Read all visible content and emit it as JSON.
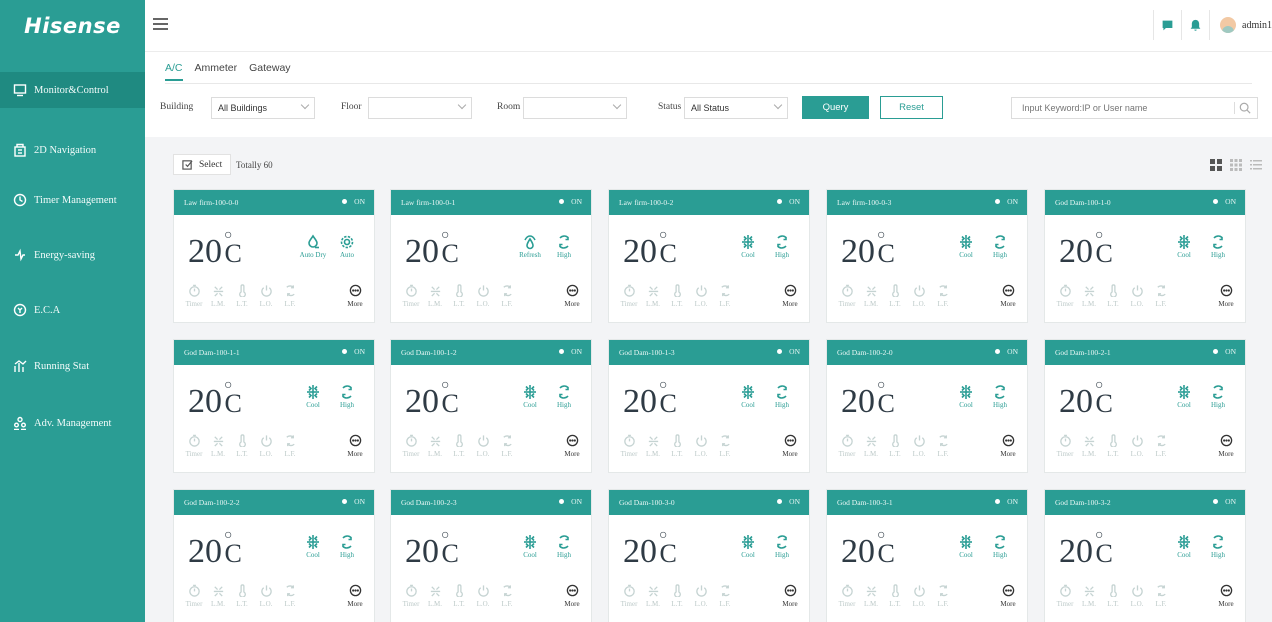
{
  "brand": {
    "logo": "Hisense",
    "accent": "#2a9d94"
  },
  "sidebar": {
    "items": [
      {
        "label": "Monitor&Control",
        "icon": "monitor-icon",
        "active": true
      },
      {
        "label": "2D Navigation",
        "icon": "building-icon"
      },
      {
        "label": "Timer Management",
        "icon": "clock-icon"
      },
      {
        "label": "Energy-saving",
        "icon": "energy-icon"
      },
      {
        "label": "E.C.A",
        "icon": "eca-icon"
      },
      {
        "label": "Running Stat",
        "icon": "stats-icon"
      },
      {
        "label": "Adv. Management",
        "icon": "users-icon"
      }
    ]
  },
  "header": {
    "username": "admin1",
    "icons": [
      "message-icon",
      "bell-icon",
      "avatar"
    ]
  },
  "tabs": [
    {
      "label": "A/C",
      "active": true
    },
    {
      "label": "Ammeter"
    },
    {
      "label": "Gateway"
    }
  ],
  "filters": {
    "building_label": "Building",
    "building_value": "All Buildings",
    "floor_label": "Floor",
    "floor_value": "",
    "room_label": "Room",
    "room_value": "",
    "status_label": "Status",
    "status_value": "All Status",
    "query_label": "Query",
    "reset_label": "Reset",
    "search_placeholder": "Input Keyword:IP or User name"
  },
  "toolbar": {
    "select_label": "Select",
    "total_label": "Totally 60"
  },
  "units": [
    {
      "name": "Law firm-100-0-0",
      "status": "ON",
      "temp": "20",
      "unit": "C",
      "mode": "Auto Dry",
      "mode_icon": "dry-icon",
      "fan": "Auto",
      "fan_icon": "gear-icon"
    },
    {
      "name": "Law firm-100-0-1",
      "status": "ON",
      "temp": "20",
      "unit": "C",
      "mode": "Refresh",
      "mode_icon": "refresh-icon",
      "fan": "High",
      "fan_icon": "fan-speed-icon"
    },
    {
      "name": "Law firm-100-0-2",
      "status": "ON",
      "temp": "20",
      "unit": "C",
      "mode": "Cool",
      "mode_icon": "snowflake-icon",
      "fan": "High",
      "fan_icon": "fan-speed-icon"
    },
    {
      "name": "Law firm-100-0-3",
      "status": "ON",
      "temp": "20",
      "unit": "C",
      "mode": "Cool",
      "mode_icon": "snowflake-icon",
      "fan": "High",
      "fan_icon": "fan-speed-icon"
    },
    {
      "name": "God Dam-100-1-0",
      "status": "ON",
      "temp": "20",
      "unit": "C",
      "mode": "Cool",
      "mode_icon": "snowflake-icon",
      "fan": "High",
      "fan_icon": "fan-speed-icon"
    },
    {
      "name": "God Dam-100-1-1",
      "status": "ON",
      "temp": "20",
      "unit": "C",
      "mode": "Cool",
      "mode_icon": "snowflake-icon",
      "fan": "High",
      "fan_icon": "fan-speed-icon"
    },
    {
      "name": "God Dam-100-1-2",
      "status": "ON",
      "temp": "20",
      "unit": "C",
      "mode": "Cool",
      "mode_icon": "snowflake-icon",
      "fan": "High",
      "fan_icon": "fan-speed-icon"
    },
    {
      "name": "God Dam-100-1-3",
      "status": "ON",
      "temp": "20",
      "unit": "C",
      "mode": "Cool",
      "mode_icon": "snowflake-icon",
      "fan": "High",
      "fan_icon": "fan-speed-icon"
    },
    {
      "name": "God Dam-100-2-0",
      "status": "ON",
      "temp": "20",
      "unit": "C",
      "mode": "Cool",
      "mode_icon": "snowflake-icon",
      "fan": "High",
      "fan_icon": "fan-speed-icon"
    },
    {
      "name": "God Dam-100-2-1",
      "status": "ON",
      "temp": "20",
      "unit": "C",
      "mode": "Cool",
      "mode_icon": "snowflake-icon",
      "fan": "High",
      "fan_icon": "fan-speed-icon"
    },
    {
      "name": "God Dam-100-2-2",
      "status": "ON",
      "temp": "20",
      "unit": "C",
      "mode": "Cool",
      "mode_icon": "snowflake-icon",
      "fan": "High",
      "fan_icon": "fan-speed-icon"
    },
    {
      "name": "God Dam-100-2-3",
      "status": "ON",
      "temp": "20",
      "unit": "C",
      "mode": "Cool",
      "mode_icon": "snowflake-icon",
      "fan": "High",
      "fan_icon": "fan-speed-icon"
    },
    {
      "name": "God Dam-100-3-0",
      "status": "ON",
      "temp": "20",
      "unit": "C",
      "mode": "Cool",
      "mode_icon": "snowflake-icon",
      "fan": "High",
      "fan_icon": "fan-speed-icon"
    },
    {
      "name": "God Dam-100-3-1",
      "status": "ON",
      "temp": "20",
      "unit": "C",
      "mode": "Cool",
      "mode_icon": "snowflake-icon",
      "fan": "High",
      "fan_icon": "fan-speed-icon"
    },
    {
      "name": "God Dam-100-3-2",
      "status": "ON",
      "temp": "20",
      "unit": "C",
      "mode": "Cool",
      "mode_icon": "snowflake-icon",
      "fan": "High",
      "fan_icon": "fan-speed-icon"
    }
  ],
  "functions": [
    {
      "label": "Timer",
      "icon": "timer-icon"
    },
    {
      "label": "L.M.",
      "icon": "lock-mode-icon"
    },
    {
      "label": "L.T.",
      "icon": "lock-temp-icon"
    },
    {
      "label": "L.O.",
      "icon": "lock-onoff-icon"
    },
    {
      "label": "L.F.",
      "icon": "lock-fan-icon"
    }
  ],
  "more_label": "More"
}
